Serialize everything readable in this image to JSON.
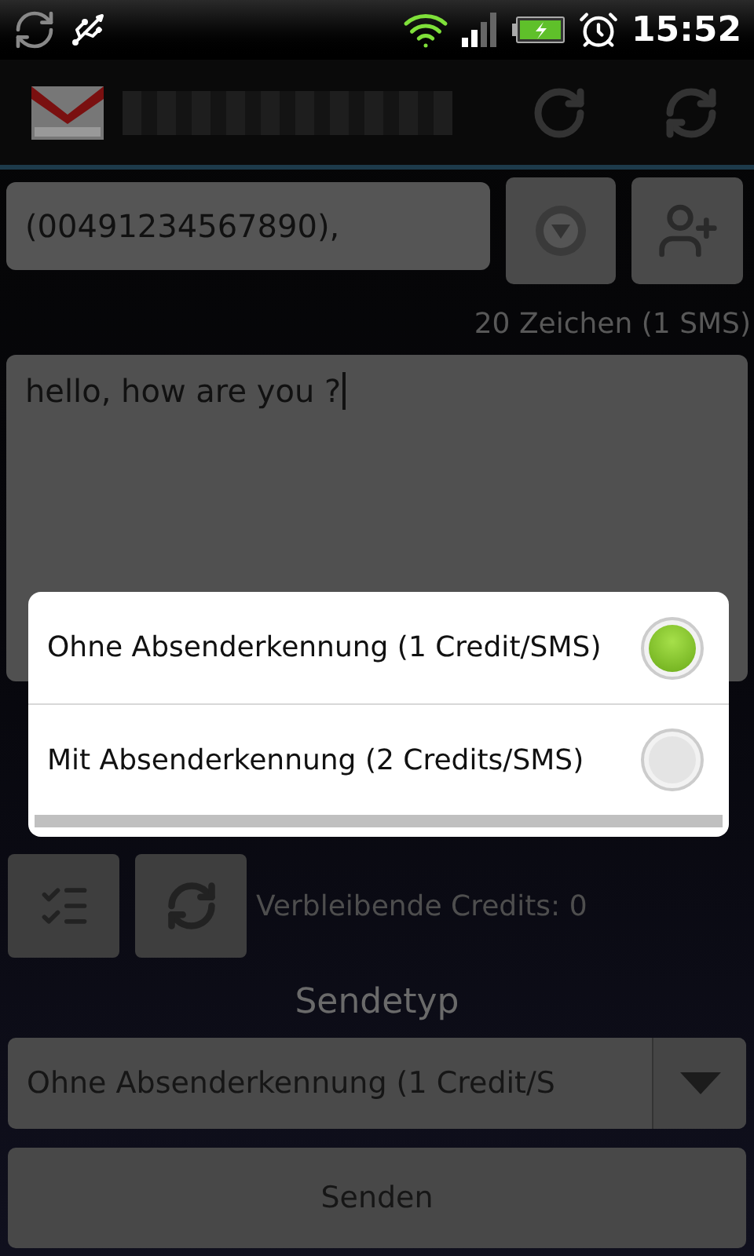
{
  "status_bar": {
    "time": "15:52"
  },
  "recipient": {
    "value": "(00491234567890),"
  },
  "char_count": "20 Zeichen (1 SMS)",
  "message": {
    "value": "hello, how are you ?"
  },
  "dialog": {
    "options": [
      {
        "label": "Ohne Absenderkennung (1 Credit/SMS)",
        "selected": true
      },
      {
        "label": "Mit Absenderkennung (2 Credits/SMS)",
        "selected": false
      }
    ]
  },
  "credits": "Verbleibende Credits: 0",
  "send_type": {
    "label": "Sendetyp",
    "value": "Ohne Absenderkennung (1 Credit/S"
  },
  "send_button": "Senden"
}
